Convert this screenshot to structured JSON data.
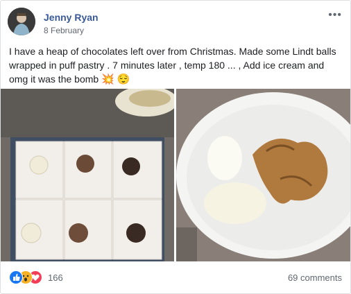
{
  "post": {
    "author": "Jenny Ryan",
    "date": "8 February",
    "text": "I have a heap of chocolates left over from Christmas. Made some Lindt balls wrapped in puff pastry . 7 minutes later , temp 180 ... , Add ice cream and omg it was the bomb",
    "emoji": [
      "💥",
      "😌"
    ]
  },
  "menu": {
    "more_icon": "•••"
  },
  "reactions": {
    "types": [
      "like-icon",
      "wow-icon",
      "love-icon"
    ],
    "count": "166",
    "comments": "69 comments"
  },
  "colors": {
    "author": "#385898",
    "like": "#1877f2",
    "wow": "#f7b125",
    "love": "#f33e58"
  }
}
